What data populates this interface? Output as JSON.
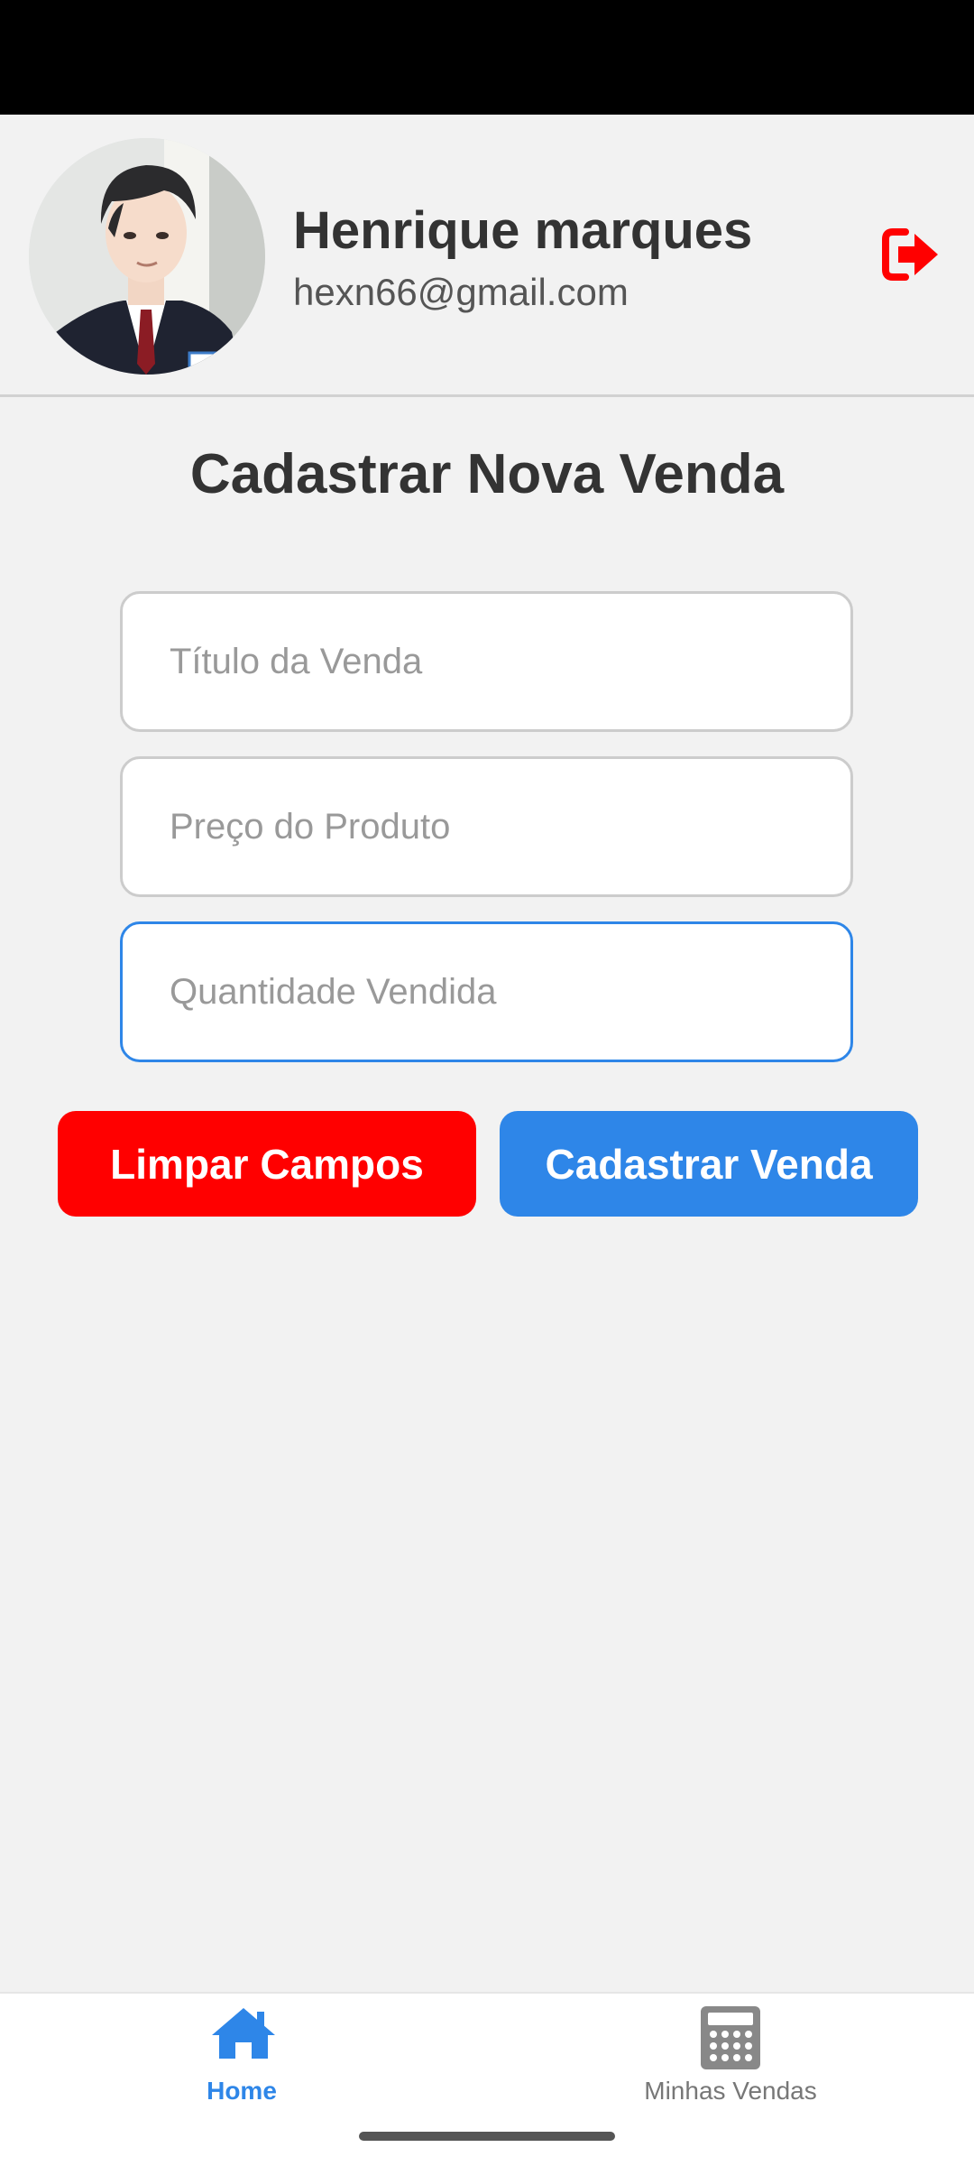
{
  "header": {
    "user_name": "Henrique marques",
    "user_email": "hexn66@gmail.com",
    "logout_icon": "logout-icon",
    "avatar_icon": "avatar"
  },
  "page": {
    "title": "Cadastrar Nova Venda"
  },
  "form": {
    "title_placeholder": "Título da Venda",
    "title_value": "",
    "price_placeholder": "Preço do Produto",
    "price_value": "",
    "quantity_placeholder": "Quantidade Vendida",
    "quantity_value": ""
  },
  "buttons": {
    "clear_label": "Limpar Campos",
    "submit_label": "Cadastrar Venda"
  },
  "nav": {
    "items": [
      {
        "label": "Home",
        "icon": "home-icon",
        "active": true
      },
      {
        "label": "Minhas Vendas",
        "icon": "calculator-icon",
        "active": false
      }
    ]
  },
  "colors": {
    "accent": "#2e86e8",
    "danger": "#ff0000",
    "background": "#f2f2f2",
    "status_bar": "#000000"
  }
}
